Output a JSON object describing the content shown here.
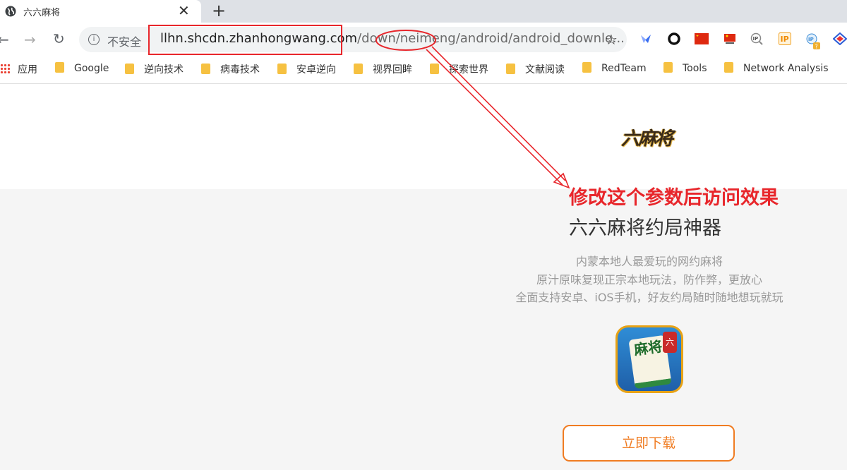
{
  "tab": {
    "title": "六六麻将",
    "close": "✕",
    "new_tab": "+"
  },
  "toolbar": {
    "back": "←",
    "forward": "→",
    "reload": "↻",
    "info": "i",
    "security_label": "不安全",
    "url_host": "llhn.shcdn.zhanhongwang.com",
    "url_path": "/down/neimeng/android/android_downlo...",
    "star": "☆"
  },
  "extensions": [
    "lark-icon",
    "circle-icon",
    "china-flag-icon",
    "china-flag-small-icon",
    "ip-search-icon",
    "ip-icon",
    "ip-question-icon",
    "diamond-icon"
  ],
  "bookmarks": [
    {
      "label": "应用",
      "type": "apps"
    },
    {
      "label": "Google",
      "type": "folder"
    },
    {
      "label": "逆向技术",
      "type": "folder"
    },
    {
      "label": "病毒技术",
      "type": "folder"
    },
    {
      "label": "安卓逆向",
      "type": "folder"
    },
    {
      "label": "视界回眸",
      "type": "folder"
    },
    {
      "label": "探索世界",
      "type": "folder"
    },
    {
      "label": "文献阅读",
      "type": "folder"
    },
    {
      "label": "RedTeam",
      "type": "folder"
    },
    {
      "label": "Tools",
      "type": "folder"
    },
    {
      "label": "Network Analysis",
      "type": "folder"
    }
  ],
  "page": {
    "logo_text": "六麻将",
    "annotation": "修改这个参数后访问效果",
    "headline": "六六麻将约局神器",
    "description": [
      "内蒙本地人最爱玩的网约麻将",
      "原汁原味复现正宗本地玩法，防作弊，更放心",
      "全面支持安卓、iOS手机，好友约局随时随地想玩就玩"
    ],
    "app_icon_text": "麻将",
    "app_icon_ribbon": "六",
    "download_button": "立即下载"
  },
  "colors": {
    "annotation": "#e8262b",
    "download": "#f07c22",
    "bookmark_folder": "#f6c141"
  }
}
